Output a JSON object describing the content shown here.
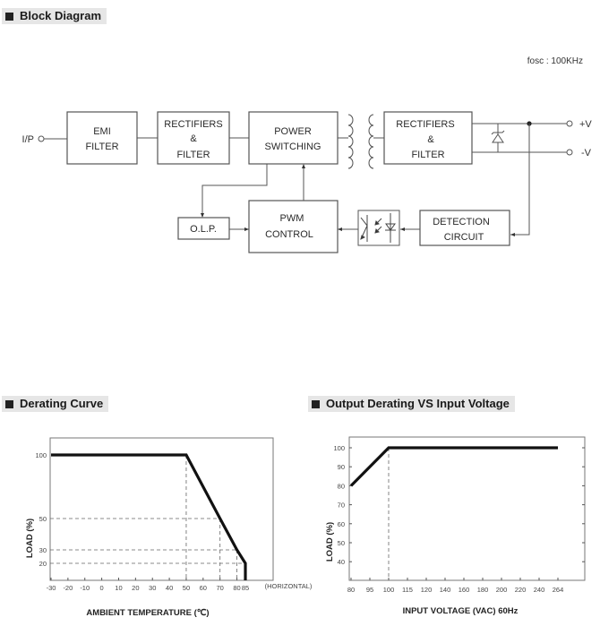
{
  "sections": {
    "block_diagram_title": "Block Diagram",
    "derating_title": "Derating Curve",
    "input_derating_title": "Output Derating VS Input Voltage"
  },
  "block_diagram": {
    "fosc_label": "fosc : 100KHz",
    "input_label": "I/P",
    "output_pos_label": "+V",
    "output_neg_label": "-V",
    "blocks": {
      "emi_filter": [
        "EMI",
        "FILTER"
      ],
      "rectifiers_filter_primary": [
        "RECTIFIERS",
        "&",
        "FILTER"
      ],
      "power_switching": [
        "POWER",
        "SWITCHING"
      ],
      "rectifiers_filter_secondary": [
        "RECTIFIERS",
        "&",
        "FILTER"
      ],
      "olp": [
        "O.L.P."
      ],
      "pwm_control": [
        "PWM",
        "CONTROL"
      ],
      "detection_circuit": [
        "DETECTION",
        "CIRCUIT"
      ]
    },
    "icons": {
      "transformer": "transformer-icon",
      "zener": "zener-diode-icon",
      "optocoupler": "optocoupler-icon",
      "terminal": "terminal-circle-icon"
    }
  },
  "chart_data": [
    {
      "type": "line",
      "title": "Derating Curve",
      "xlabel": "AMBIENT TEMPERATURE (℃)",
      "ylabel": "LOAD (%)",
      "x_note": "(HORIZONTAL)",
      "xticks": [
        -30,
        -20,
        -10,
        0,
        10,
        20,
        30,
        40,
        50,
        60,
        70,
        80,
        85
      ],
      "yticks": [
        20,
        30,
        50,
        100
      ],
      "xlim": [
        -30,
        85
      ],
      "series": [
        {
          "name": "Load",
          "x": [
            -30,
            50,
            70,
            80,
            85,
            85
          ],
          "y": [
            100,
            100,
            50,
            30,
            20,
            0
          ]
        }
      ],
      "reference_lines": [
        {
          "x": 50,
          "y": 100
        },
        {
          "x": 70,
          "y": 50
        },
        {
          "x": 80,
          "y": 30
        },
        {
          "x": 85,
          "y": 20
        }
      ],
      "grid": false
    },
    {
      "type": "line",
      "title": "Output Derating VS Input Voltage",
      "xlabel": "INPUT VOLTAGE (VAC) 60Hz",
      "ylabel": "LOAD (%)",
      "xticks": [
        "80",
        "95",
        "100",
        "115",
        "120",
        "140",
        "160",
        "180",
        "200",
        "220",
        "240",
        "264"
      ],
      "yticks": [
        40,
        50,
        60,
        70,
        80,
        90,
        100
      ],
      "series": [
        {
          "name": "Load",
          "x": [
            "80",
            "100",
            "264"
          ],
          "y": [
            80,
            100,
            100
          ]
        }
      ],
      "reference_lines": [
        {
          "x": "100",
          "y": 100
        }
      ],
      "grid": false
    }
  ]
}
